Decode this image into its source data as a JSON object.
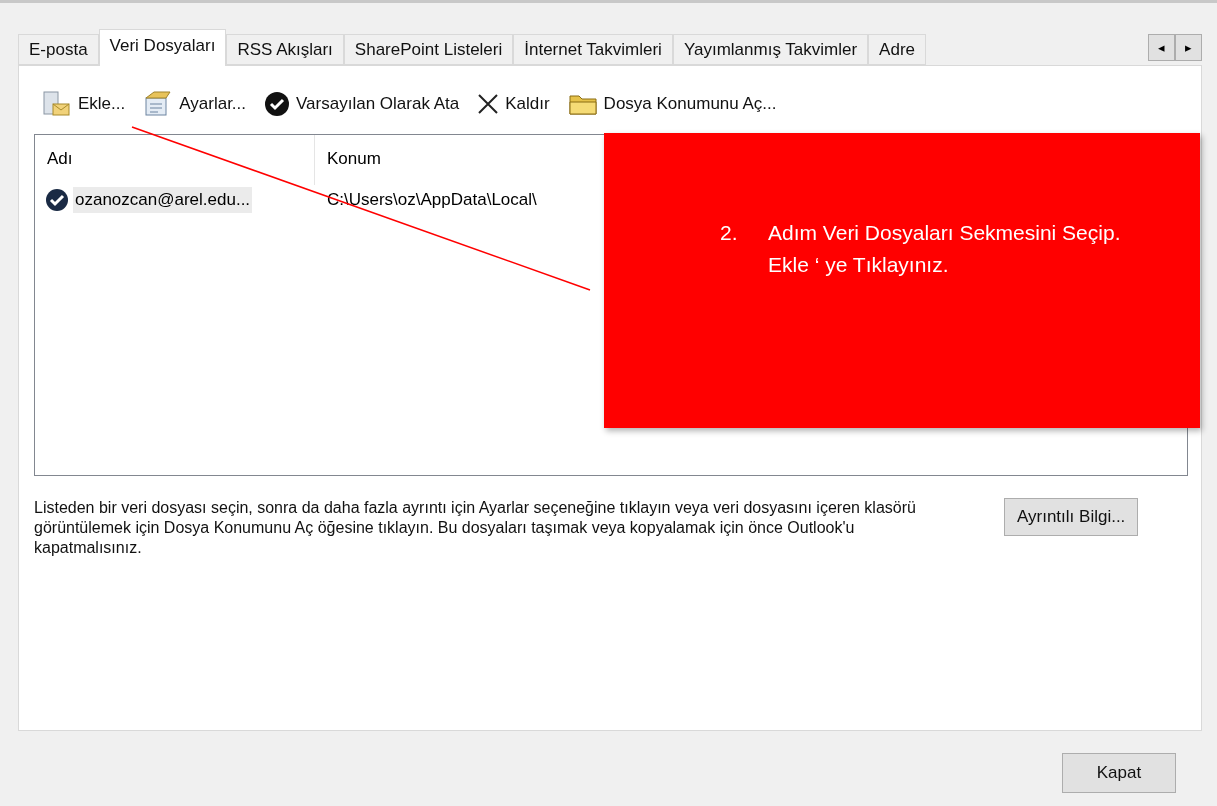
{
  "tabs": [
    {
      "label": "E-posta",
      "selected": false
    },
    {
      "label": "Veri Dosyaları",
      "selected": true
    },
    {
      "label": "RSS Akışları",
      "selected": false
    },
    {
      "label": "SharePoint Listeleri",
      "selected": false
    },
    {
      "label": "İnternet Takvimleri",
      "selected": false
    },
    {
      "label": "Yayımlanmış Takvimler",
      "selected": false
    },
    {
      "label": "Adre",
      "selected": false
    }
  ],
  "tab_scroll": {
    "left": "◂",
    "right": "▸"
  },
  "toolbar": [
    {
      "kind": "add",
      "label": "Ekle..."
    },
    {
      "kind": "settings",
      "label": "Ayarlar..."
    },
    {
      "kind": "default",
      "label": "Varsayılan Olarak Ata"
    },
    {
      "kind": "remove",
      "label": "Kaldır"
    },
    {
      "kind": "folder",
      "label": "Dosya Konumunu Aç..."
    }
  ],
  "table": {
    "columns": [
      "Adı",
      "Konum"
    ],
    "rows": [
      {
        "name": "ozanozcan@arel.edu...",
        "location": "C:\\Users\\oz\\AppData\\Local\\",
        "default": true,
        "selected": true
      }
    ]
  },
  "description": "Listeden bir veri dosyası seçin, sonra da daha fazla ayrıntı için Ayarlar seçeneğine tıklayın veya veri dosyasını içeren klasörü görüntülemek için Dosya Konumunu Aç öğesine tıklayın. Bu dosyaları taşımak veya kopyalamak için önce Outlook'u kapatmalısınız.",
  "details_button": "Ayrıntılı Bilgi...",
  "close_button": "Kapat",
  "callout": {
    "number": "2.",
    "text": "Adım Veri Dosyaları Sekmesini Seçip.",
    "text_2": "Ekle ‘ ye Tıklayınız."
  }
}
